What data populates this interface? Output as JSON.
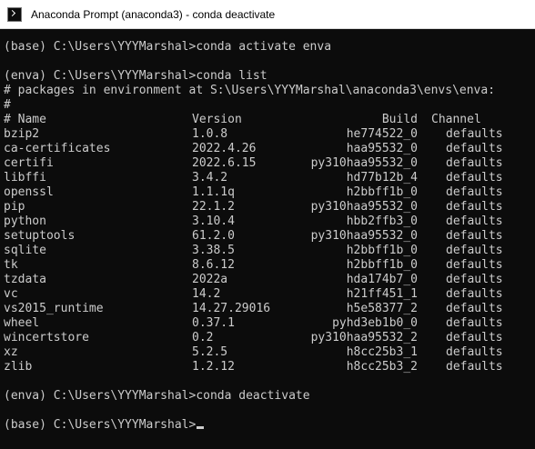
{
  "window": {
    "title": "Anaconda Prompt (anaconda3) - conda  deactivate",
    "icon": "terminal-icon"
  },
  "console": {
    "prompt_activate": "(base) C:\\Users\\YYYMarshal>conda activate enva",
    "prompt_list": "(enva) C:\\Users\\YYYMarshal>conda list",
    "env_comment": "# packages in environment at S:\\Users\\YYYMarshal\\anaconda3\\envs\\enva:",
    "hash_line": "#",
    "columns": {
      "name": "# Name",
      "version": "Version",
      "build": "Build",
      "channel": "Channel"
    },
    "packages": [
      {
        "name": "bzip2",
        "version": "1.0.8",
        "build": "he774522_0",
        "channel": "defaults"
      },
      {
        "name": "ca-certificates",
        "version": "2022.4.26",
        "build": "haa95532_0",
        "channel": "defaults"
      },
      {
        "name": "certifi",
        "version": "2022.6.15",
        "build": "py310haa95532_0",
        "channel": "defaults"
      },
      {
        "name": "libffi",
        "version": "3.4.2",
        "build": "hd77b12b_4",
        "channel": "defaults"
      },
      {
        "name": "openssl",
        "version": "1.1.1q",
        "build": "h2bbff1b_0",
        "channel": "defaults"
      },
      {
        "name": "pip",
        "version": "22.1.2",
        "build": "py310haa95532_0",
        "channel": "defaults"
      },
      {
        "name": "python",
        "version": "3.10.4",
        "build": "hbb2ffb3_0",
        "channel": "defaults"
      },
      {
        "name": "setuptools",
        "version": "61.2.0",
        "build": "py310haa95532_0",
        "channel": "defaults"
      },
      {
        "name": "sqlite",
        "version": "3.38.5",
        "build": "h2bbff1b_0",
        "channel": "defaults"
      },
      {
        "name": "tk",
        "version": "8.6.12",
        "build": "h2bbff1b_0",
        "channel": "defaults"
      },
      {
        "name": "tzdata",
        "version": "2022a",
        "build": "hda174b7_0",
        "channel": "defaults"
      },
      {
        "name": "vc",
        "version": "14.2",
        "build": "h21ff451_1",
        "channel": "defaults"
      },
      {
        "name": "vs2015_runtime",
        "version": "14.27.29016",
        "build": "h5e58377_2",
        "channel": "defaults"
      },
      {
        "name": "wheel",
        "version": "0.37.1",
        "build": "pyhd3eb1b0_0",
        "channel": "defaults"
      },
      {
        "name": "wincertstore",
        "version": "0.2",
        "build": "py310haa95532_2",
        "channel": "defaults"
      },
      {
        "name": "xz",
        "version": "5.2.5",
        "build": "h8cc25b3_1",
        "channel": "defaults"
      },
      {
        "name": "zlib",
        "version": "1.2.12",
        "build": "h8cc25b3_2",
        "channel": "defaults"
      }
    ],
    "prompt_deactivate": "(enva) C:\\Users\\YYYMarshal>conda deactivate",
    "prompt_current": "(base) C:\\Users\\YYYMarshal>"
  },
  "colors": {
    "background": "#0c0c0c",
    "text": "#cccccc",
    "titlebar": "#ffffff"
  }
}
